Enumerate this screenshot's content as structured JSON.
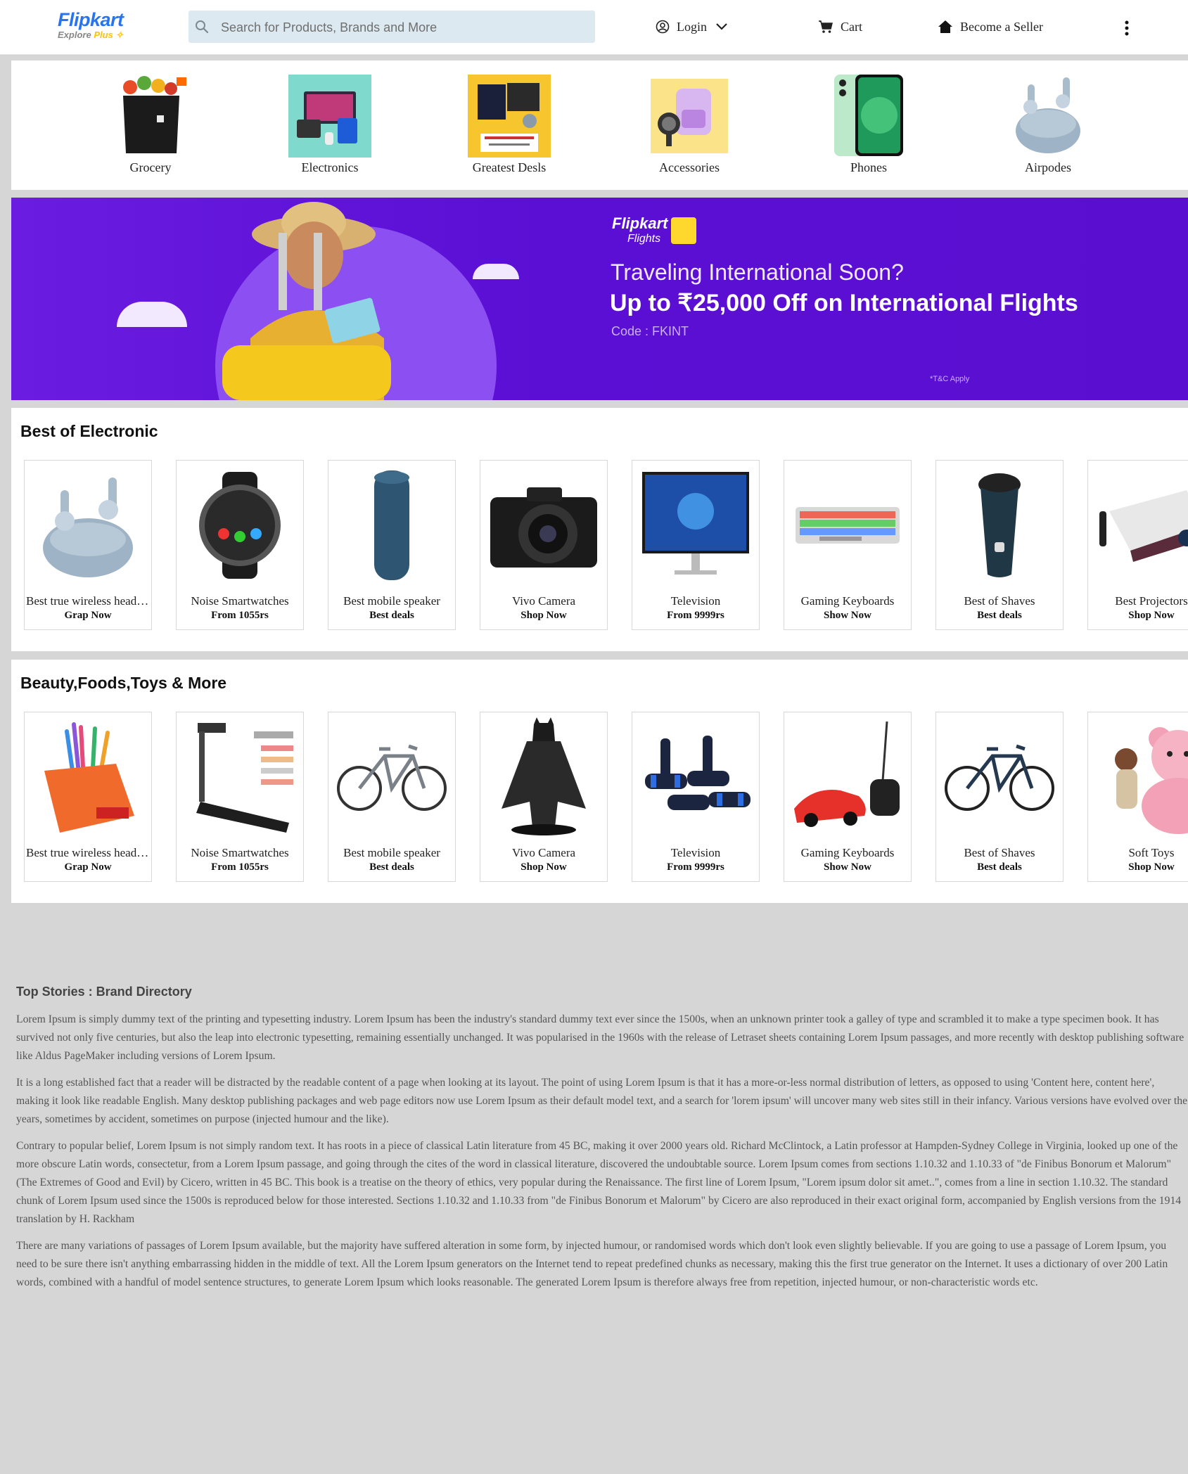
{
  "header": {
    "logo": "Flipkart",
    "logo_sub": "Explore",
    "logo_plus": "Plus",
    "search_placeholder": "Search for Products, Brands and More",
    "login": "Login",
    "cart": "Cart",
    "seller": "Become a Seller"
  },
  "categories": [
    {
      "label": "Grocery",
      "icon": "grocery-bag-icon"
    },
    {
      "label": "Electronics",
      "icon": "electronics-icon"
    },
    {
      "label": "Greatest Desls",
      "icon": "deals-icon"
    },
    {
      "label": "Accessories",
      "icon": "backpack-icon"
    },
    {
      "label": "Phones",
      "icon": "phone-icon"
    },
    {
      "label": "Airpodes",
      "icon": "earbuds-icon"
    }
  ],
  "banner": {
    "brand": "Flipkart",
    "brand_sub": "Flights",
    "line1": "Traveling International Soon?",
    "line2": "Up to ₹25,000 Off on International Flights",
    "code": "Code : FKINT",
    "tc": "*T&C Apply"
  },
  "section1": {
    "title": "Best of Electronic",
    "cards": [
      {
        "name": "Best true wireless headphones",
        "sub": "Grap Now",
        "icon": "earbuds-icon"
      },
      {
        "name": "Noise Smartwatches",
        "sub": "From 1055rs",
        "icon": "smartwatch-icon"
      },
      {
        "name": "Best mobile speaker",
        "sub": "Best deals",
        "icon": "speaker-icon"
      },
      {
        "name": "Vivo Camera",
        "sub": "Shop Now",
        "icon": "camera-icon"
      },
      {
        "name": "Television",
        "sub": "From 9999rs",
        "icon": "monitor-icon"
      },
      {
        "name": "Gaming Keyboards",
        "sub": "Show Now",
        "icon": "keyboard-icon"
      },
      {
        "name": "Best of Shaves",
        "sub": "Best deals",
        "icon": "shaver-icon"
      },
      {
        "name": "Best Projectors",
        "sub": "Shop Now",
        "icon": "projector-icon"
      }
    ]
  },
  "section2": {
    "title": "Beauty,Foods,Toys & More",
    "cards": [
      {
        "name": "Best true wireless headphones",
        "sub": "Grap Now",
        "icon": "pens-icon"
      },
      {
        "name": "Noise Smartwatches",
        "sub": "From 1055rs",
        "icon": "treadmill-icon"
      },
      {
        "name": "Best mobile speaker",
        "sub": "Best deals",
        "icon": "bicycle-icon"
      },
      {
        "name": "Vivo Camera",
        "sub": "Shop Now",
        "icon": "batman-figure-icon"
      },
      {
        "name": "Television",
        "sub": "From 9999rs",
        "icon": "pushup-bars-icon"
      },
      {
        "name": "Gaming Keyboards",
        "sub": "Show Now",
        "icon": "rc-car-icon"
      },
      {
        "name": "Best of Shaves",
        "sub": "Best deals",
        "icon": "bicycle-icon"
      },
      {
        "name": "Soft Toys",
        "sub": "Shop Now",
        "icon": "teddy-bear-icon"
      }
    ]
  },
  "stories": {
    "title": "Top Stories : Brand Directory",
    "paragraphs": [
      "Lorem Ipsum is simply dummy text of the printing and typesetting industry. Lorem Ipsum has been the industry's standard dummy text ever since the 1500s, when an unknown printer took a galley of type and scrambled it to make a type specimen book. It has survived not only five centuries, but also the leap into electronic typesetting, remaining essentially unchanged. It was popularised in the 1960s with the release of Letraset sheets containing Lorem Ipsum passages, and more recently with desktop publishing software like Aldus PageMaker including versions of Lorem Ipsum.",
      "It is a long established fact that a reader will be distracted by the readable content of a page when looking at its layout. The point of using Lorem Ipsum is that it has a more-or-less normal distribution of letters, as opposed to using 'Content here, content here', making it look like readable English. Many desktop publishing packages and web page editors now use Lorem Ipsum as their default model text, and a search for 'lorem ipsum' will uncover many web sites still in their infancy. Various versions have evolved over the years, sometimes by accident, sometimes on purpose (injected humour and the like).",
      "Contrary to popular belief, Lorem Ipsum is not simply random text. It has roots in a piece of classical Latin literature from 45 BC, making it over 2000 years old. Richard McClintock, a Latin professor at Hampden-Sydney College in Virginia, looked up one of the more obscure Latin words, consectetur, from a Lorem Ipsum passage, and going through the cites of the word in classical literature, discovered the undoubtable source. Lorem Ipsum comes from sections 1.10.32 and 1.10.33 of \"de Finibus Bonorum et Malorum\" (The Extremes of Good and Evil) by Cicero, written in 45 BC. This book is a treatise on the theory of ethics, very popular during the Renaissance. The first line of Lorem Ipsum, \"Lorem ipsum dolor sit amet..\", comes from a line in section 1.10.32. The standard chunk of Lorem Ipsum used since the 1500s is reproduced below for those interested. Sections 1.10.32 and 1.10.33 from \"de Finibus Bonorum et Malorum\" by Cicero are also reproduced in their exact original form, accompanied by English versions from the 1914 translation by H. Rackham",
      "There are many variations of passages of Lorem Ipsum available, but the majority have suffered alteration in some form, by injected humour, or randomised words which don't look even slightly believable. If you are going to use a passage of Lorem Ipsum, you need to be sure there isn't anything embarrassing hidden in the middle of text. All the Lorem Ipsum generators on the Internet tend to repeat predefined chunks as necessary, making this the first true generator on the Internet. It uses a dictionary of over 200 Latin words, combined with a handful of model sentence structures, to generate Lorem Ipsum which looks reasonable. The generated Lorem Ipsum is therefore always free from repetition, injected humour, or non-characteristic words etc."
    ]
  },
  "colors": {
    "brand": "#2874f0",
    "plus": "#ffc200",
    "banner": "#5b0fd4",
    "page_bg": "#d6d6d6"
  }
}
